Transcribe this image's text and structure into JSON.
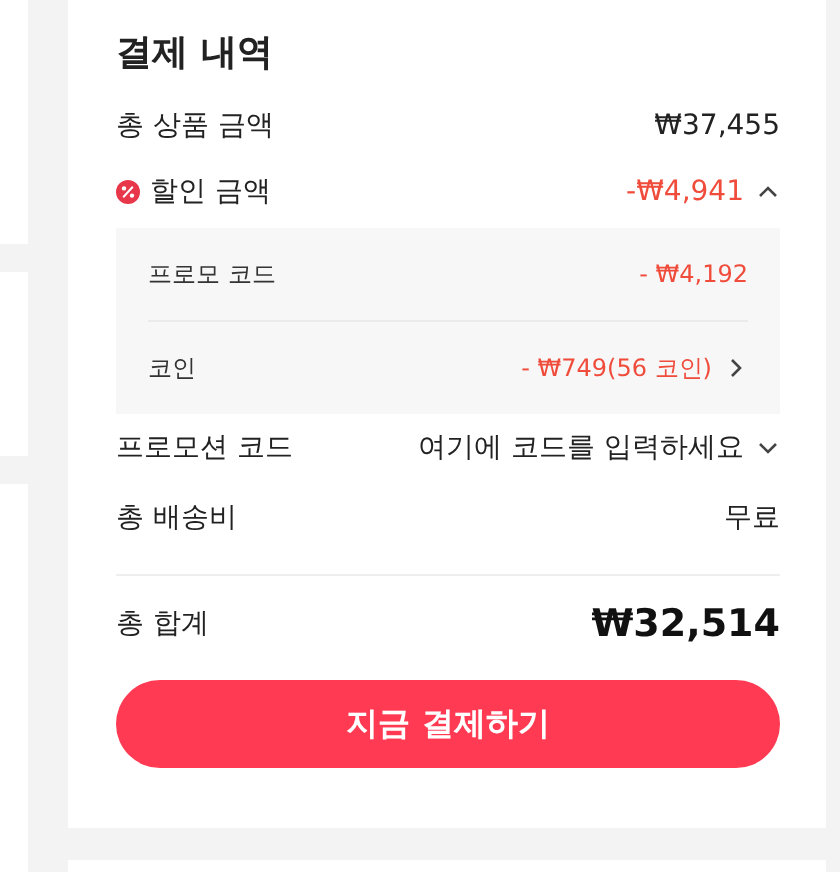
{
  "title": "결제 내역",
  "subtotal": {
    "label": "총 상품 금액",
    "value": "₩37,455"
  },
  "discount": {
    "label": "할인 금액",
    "value": "-₩4,941",
    "expanded": true,
    "items": [
      {
        "kind": "plain",
        "label": "프로모 코드",
        "value": "- ₩4,192"
      },
      {
        "kind": "link",
        "label": "코인",
        "value": "- ₩749(56 코인)"
      }
    ]
  },
  "promotion_code": {
    "label": "프로모션 코드",
    "prompt": "여기에 코드를 입력하세요",
    "expanded": false
  },
  "shipping": {
    "label": "총 배송비",
    "value": "무료"
  },
  "total": {
    "label": "총 합계",
    "value": "₩32,514"
  },
  "pay_button": "지금 결제하기"
}
